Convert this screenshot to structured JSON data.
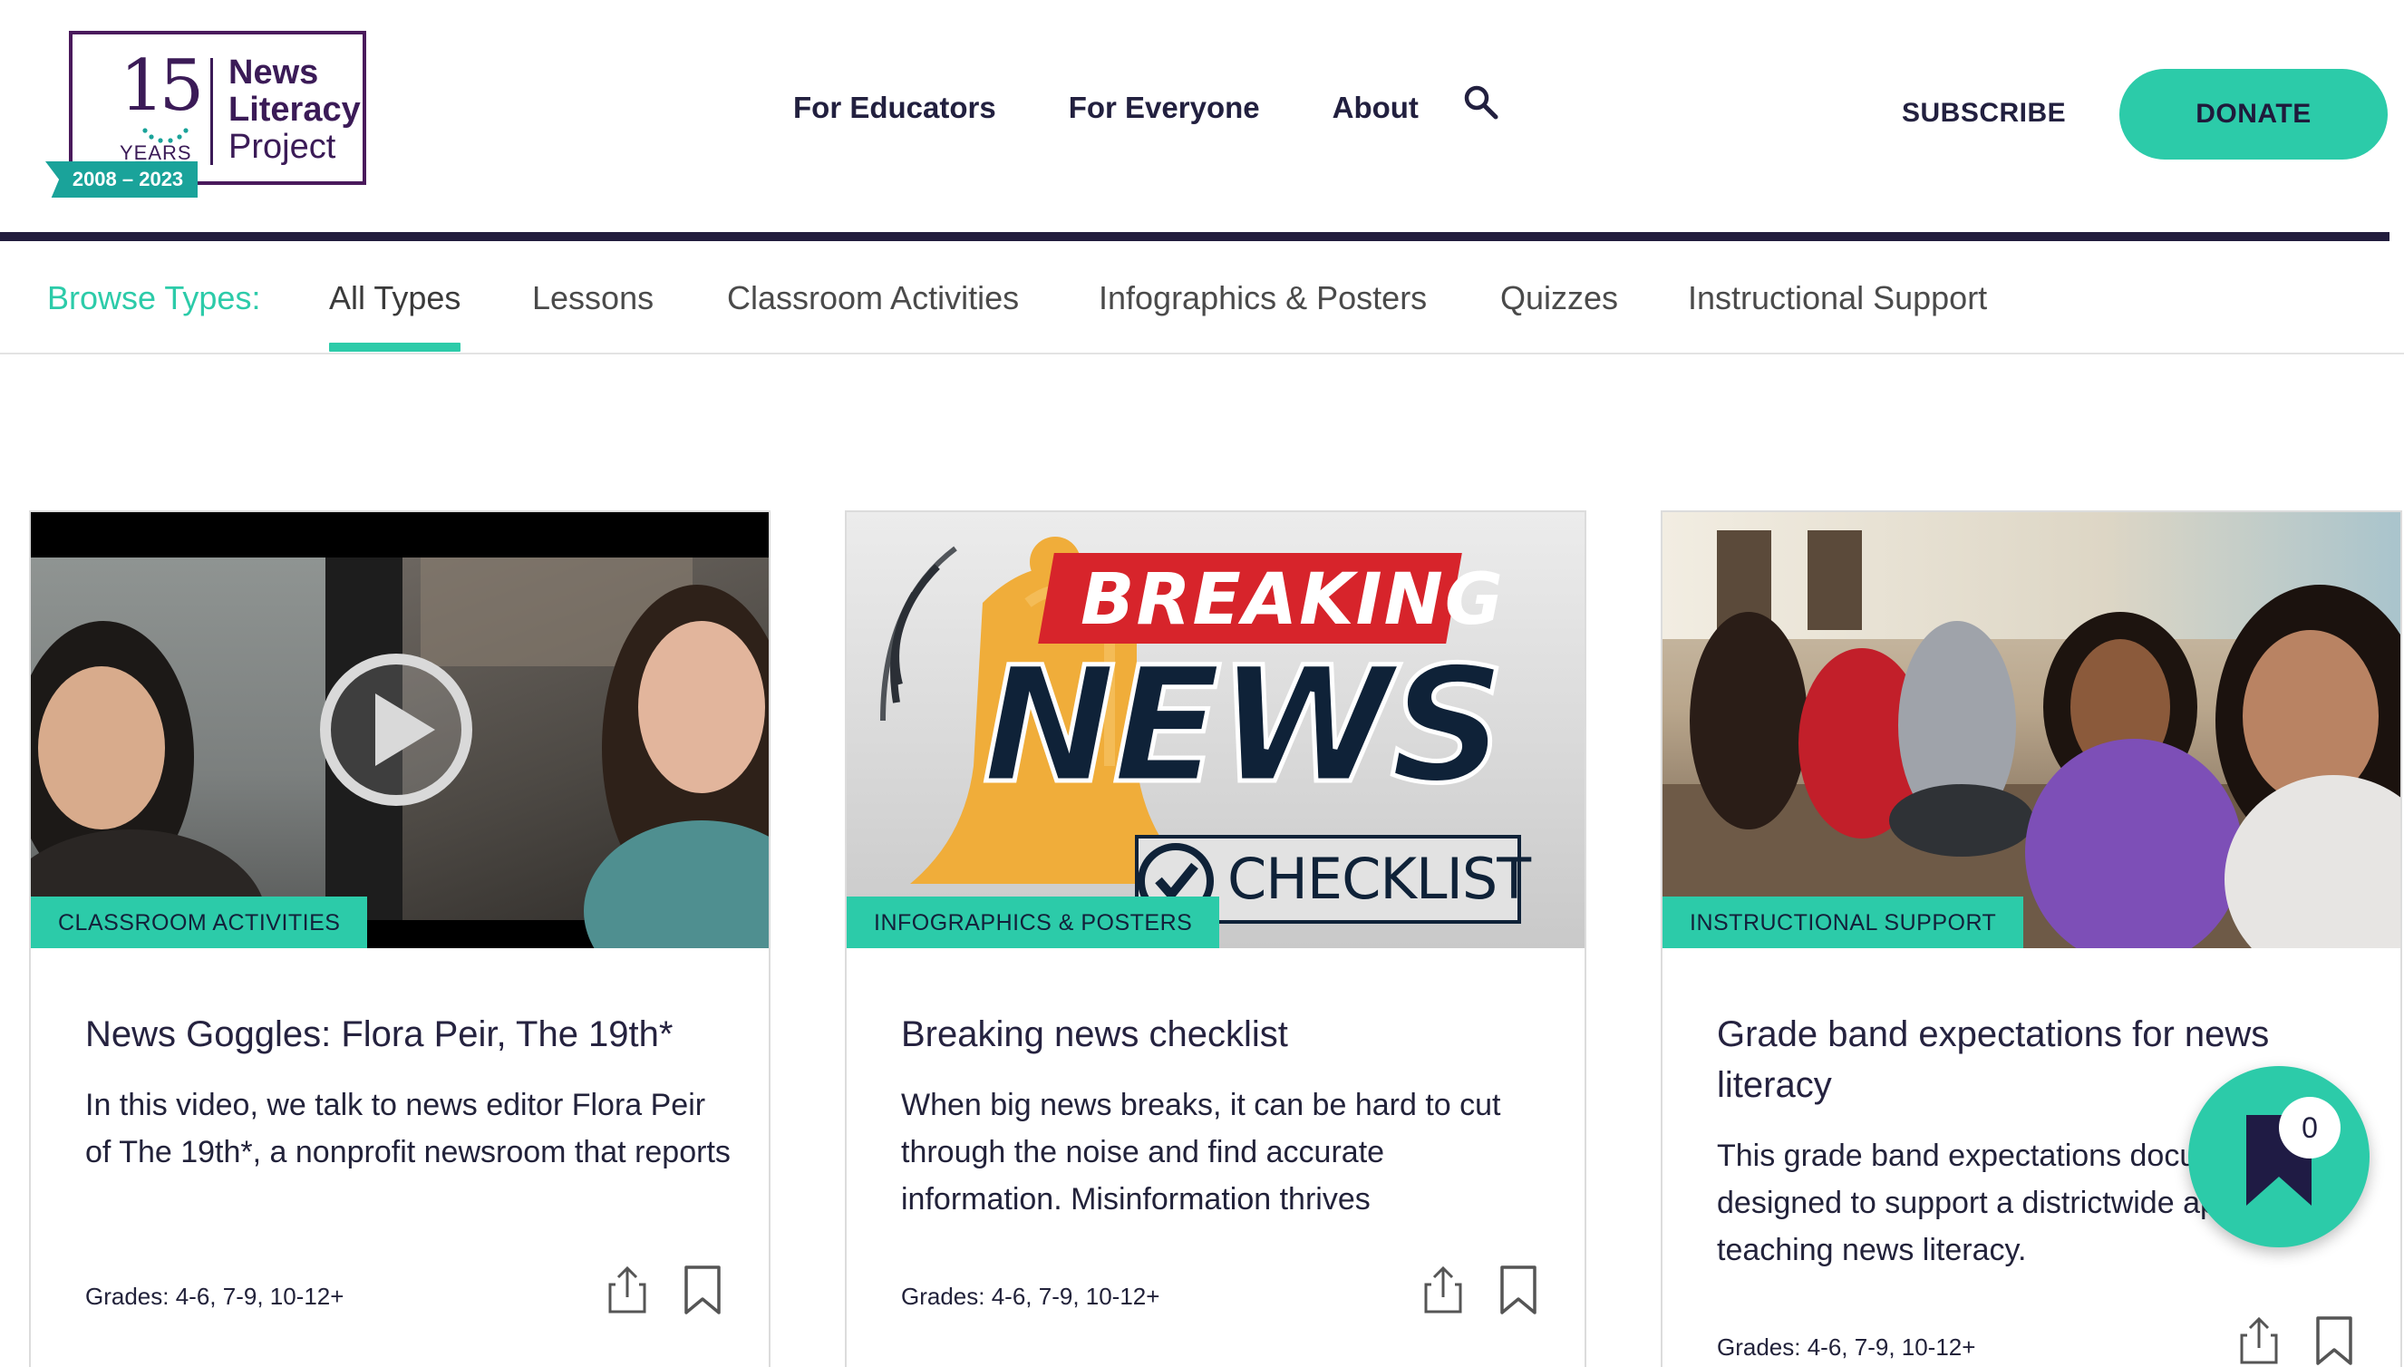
{
  "logo": {
    "number": "15",
    "years": "YEARS",
    "line1": "News",
    "line2": "Literacy",
    "line3": "Project",
    "ribbon": "2008 – 2023",
    "colors": {
      "purple": "#3b1b57",
      "teal": "#1aa39a"
    }
  },
  "nav": {
    "items": [
      "For Educators",
      "For Everyone",
      "About"
    ],
    "search_icon": "search-icon",
    "subscribe": "SUBSCRIBE",
    "donate": "DONATE"
  },
  "browse": {
    "label": "Browse Types:",
    "tabs": [
      "All Types",
      "Lessons",
      "Classroom Activities",
      "Infographics & Posters",
      "Quizzes",
      "Instructional Support"
    ],
    "active": "All Types"
  },
  "cards": [
    {
      "badge": "CLASSROOM ACTIVITIES",
      "title": "News Goggles: Flora Peir, The 19th*",
      "description": "In this video, we talk to news editor Flora Peir of The 19th*, a nonprofit newsroom that reports",
      "grades": "Grades: 4-6, 7-9, 10-12+",
      "image": "video-thumbnail"
    },
    {
      "badge": "INFOGRAPHICS & POSTERS",
      "title": "Breaking news checklist",
      "description": "When big news breaks, it can be hard to cut through the noise and find accurate information. Misinformation thrives",
      "grades": "Grades: 4-6, 7-9, 10-12+",
      "image": "breaking-news-graphic",
      "image_text": {
        "breaking": "BREAKING",
        "news": "NEWS",
        "checklist": "CHECKLIST"
      }
    },
    {
      "badge": "INSTRUCTIONAL SUPPORT",
      "title": "Grade band expectations for news literacy",
      "description": "This grade band expectations document is designed to support a districtwide approach to teaching news literacy.",
      "grades": "Grades: 4-6, 7-9, 10-12+",
      "image": "classroom-photo"
    }
  ],
  "saved": {
    "count": "0",
    "icon": "bookmark-icon"
  },
  "colors": {
    "accent": "#2ccba9",
    "navy": "#221d3d",
    "text": "#25223f"
  }
}
